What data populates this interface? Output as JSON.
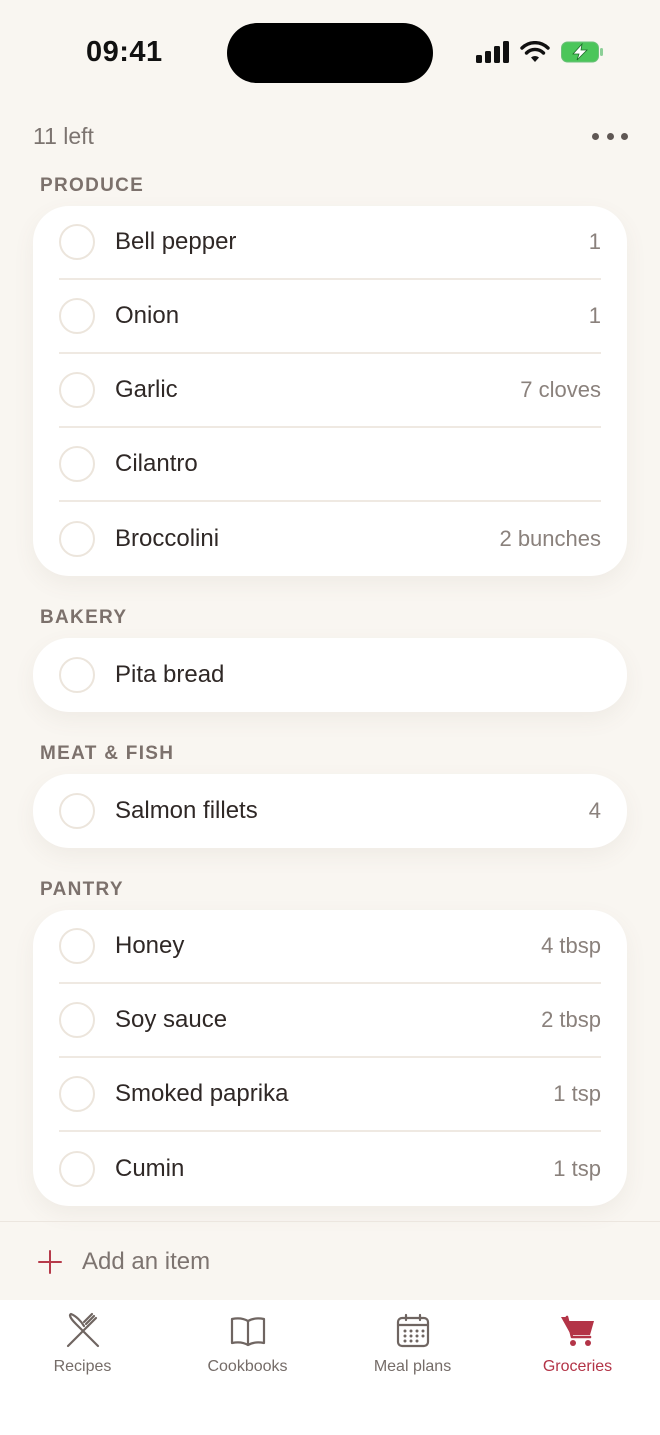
{
  "status_bar": {
    "time": "09:41"
  },
  "header": {
    "count_left": "11 left"
  },
  "sections": [
    {
      "title": "PRODUCE",
      "items": [
        {
          "name": "Bell pepper",
          "qty": "1"
        },
        {
          "name": "Onion",
          "qty": "1"
        },
        {
          "name": "Garlic",
          "qty": "7 cloves"
        },
        {
          "name": "Cilantro",
          "qty": ""
        },
        {
          "name": "Broccolini",
          "qty": "2 bunches"
        }
      ]
    },
    {
      "title": "BAKERY",
      "items": [
        {
          "name": "Pita bread",
          "qty": ""
        }
      ]
    },
    {
      "title": "MEAT & FISH",
      "items": [
        {
          "name": "Salmon fillets",
          "qty": "4"
        }
      ]
    },
    {
      "title": "PANTRY",
      "items": [
        {
          "name": "Honey",
          "qty": "4 tbsp"
        },
        {
          "name": "Soy sauce",
          "qty": "2 tbsp"
        },
        {
          "name": "Smoked paprika",
          "qty": "1 tsp"
        },
        {
          "name": "Cumin",
          "qty": "1 tsp"
        }
      ]
    }
  ],
  "add_item": {
    "label": "Add an item"
  },
  "tabs": [
    {
      "label": "Recipes",
      "icon": "fork-knife-icon",
      "active": false
    },
    {
      "label": "Cookbooks",
      "icon": "open-book-icon",
      "active": false
    },
    {
      "label": "Meal plans",
      "icon": "calendar-icon",
      "active": false
    },
    {
      "label": "Groceries",
      "icon": "cart-icon",
      "active": true
    }
  ],
  "colors": {
    "accent": "#b33447",
    "background": "#f9f6f1",
    "card": "#ffffff",
    "muted_text": "#7c7470"
  }
}
